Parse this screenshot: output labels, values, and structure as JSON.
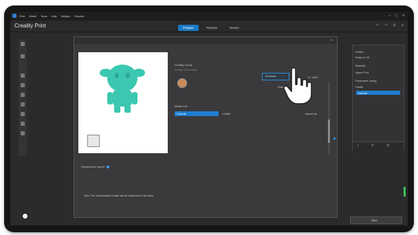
{
  "app": {
    "title": "Creality Print",
    "menu": [
      "Print",
      "Model",
      "Tools",
      "Help",
      "Multiple",
      "Reports"
    ],
    "window_controls": [
      "–",
      "▢",
      "✕"
    ]
  },
  "toolbar": {
    "tabs": [
      {
        "label": "Prepare",
        "active": true
      },
      {
        "label": "Preview",
        "active": false
      },
      {
        "label": "Device",
        "active": false
      }
    ],
    "icons": [
      "undo-icon",
      "redo-icon",
      "settings-icon",
      "user-icon"
    ]
  },
  "dialog": {
    "close": "✕",
    "creator_label": "Creality Cloud",
    "creator_sub": "Creality Cloud model",
    "download_label": "Download",
    "right_small_a": "0 / 1000",
    "right_small_b": "Details",
    "section2_label": "Model List",
    "field_value": "Groot.stl",
    "field2": "1.6MB",
    "field3": "Import all",
    "check_label": "Download & Import",
    "footer_note": "Tips: The downloaded model will be imported to the plate",
    "accent": "#1f7ed0"
  },
  "right_panel": {
    "rows": [
      {
        "label": "Printer",
        "y": 7
      },
      {
        "label": "Ender-3 V3",
        "y": 15
      },
      {
        "label": "Material",
        "y": 27
      },
      {
        "label": "Hyper PLA",
        "y": 37
      },
      {
        "label": "Parameter config",
        "y": 49
      },
      {
        "label": "Profile",
        "y": 58
      }
    ],
    "highlight_label": "Normal",
    "buttons": [
      "+",
      "⟳",
      "⚙"
    ]
  },
  "bottom": {
    "print_button": "Slice"
  }
}
